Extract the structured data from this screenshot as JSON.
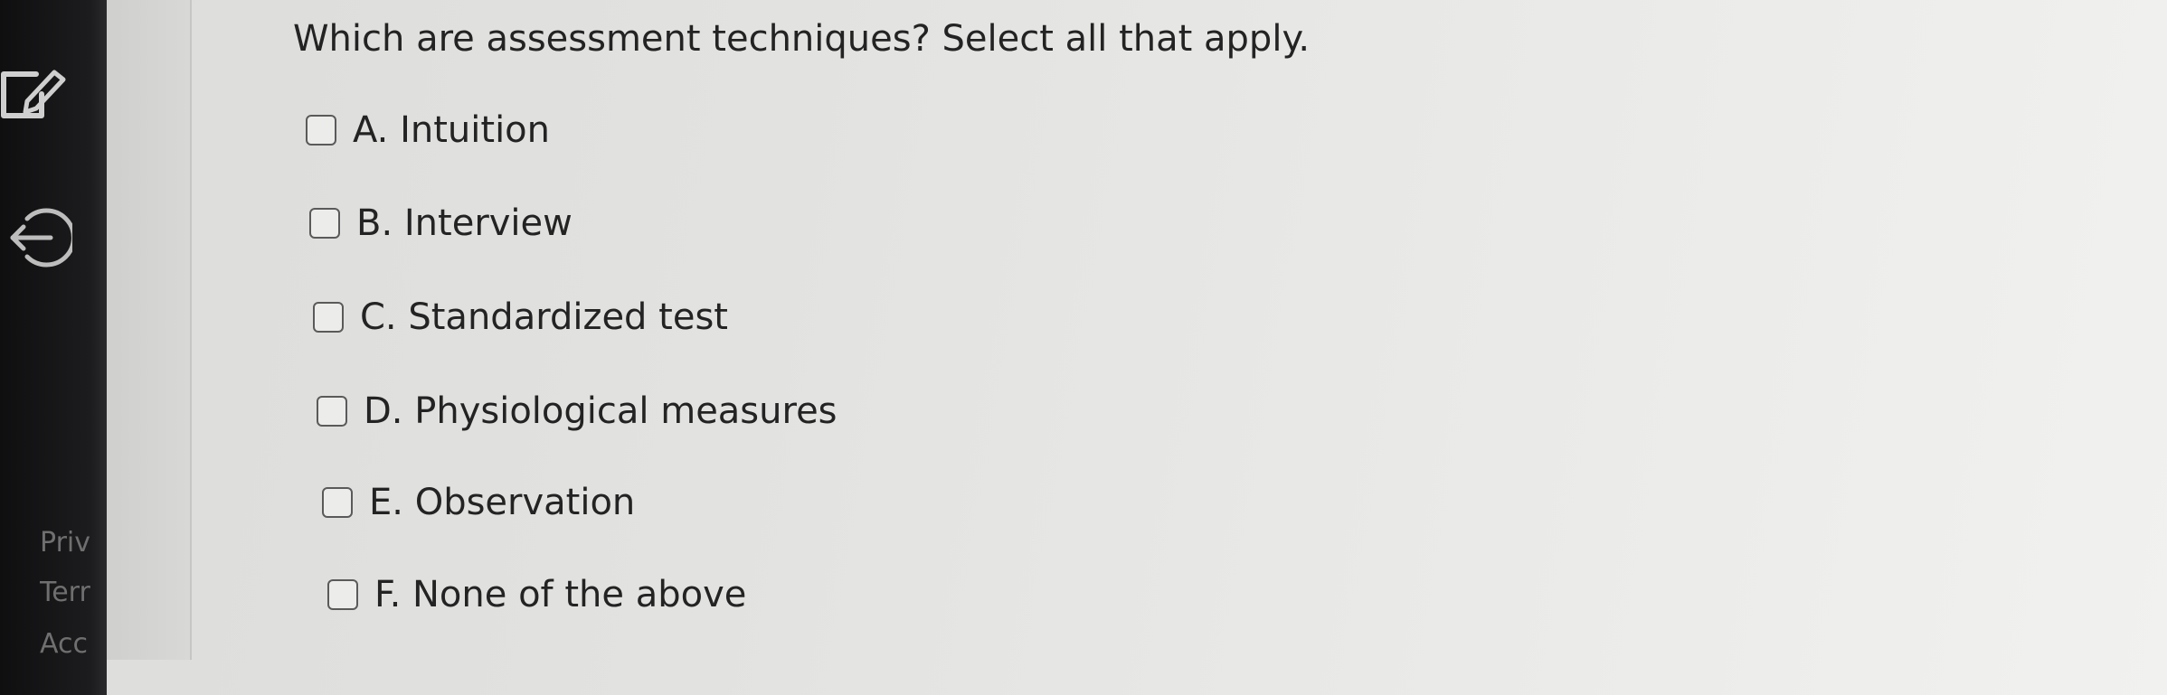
{
  "question": {
    "text": "Which are assessment techniques? Select all that apply."
  },
  "options": [
    {
      "label": "A. Intuition",
      "checked": false
    },
    {
      "label": "B. Interview",
      "checked": false
    },
    {
      "label": "C. Standardized test",
      "checked": false
    },
    {
      "label": "D. Physiological measures",
      "checked": false
    },
    {
      "label": "E. Observation",
      "checked": false
    },
    {
      "label": "F. None of the above",
      "checked": false
    }
  ],
  "sidebar": {
    "icons": [
      "edit-icon",
      "exit-icon"
    ],
    "links": [
      "Priv",
      "Terr",
      "Acc"
    ]
  },
  "colors": {
    "text": "#232323",
    "sidebar": "#1c1c1e",
    "background": "#e6e6e4"
  }
}
